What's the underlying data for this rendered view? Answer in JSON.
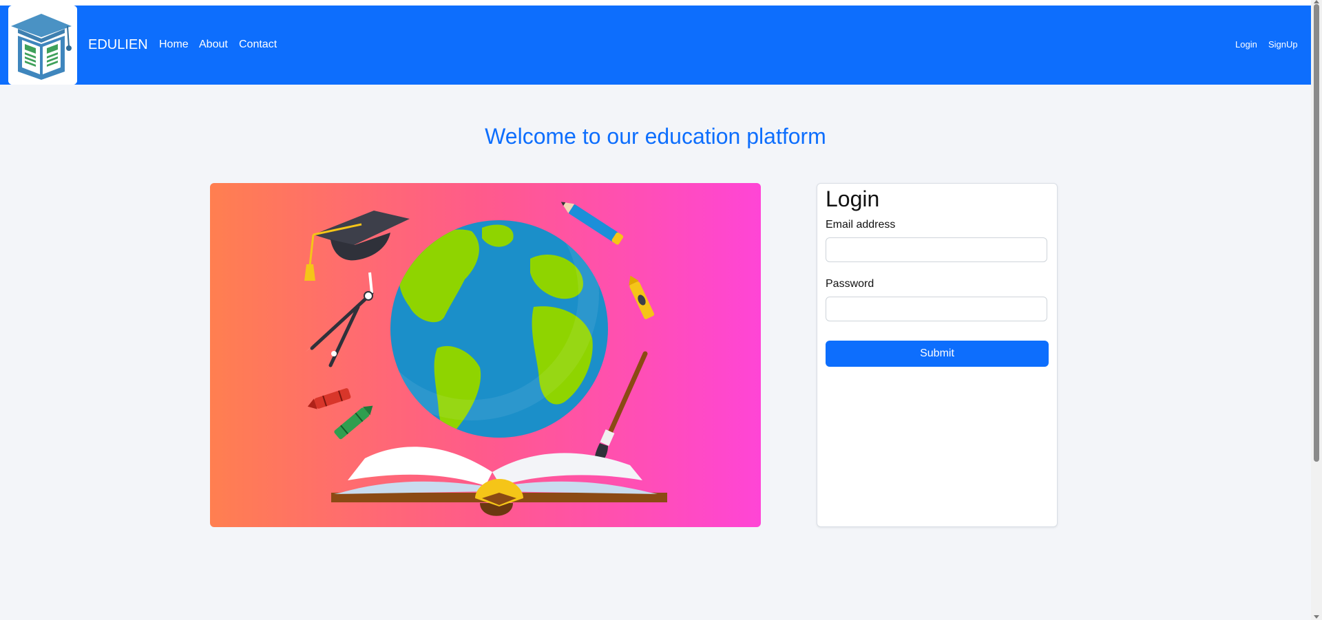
{
  "header": {
    "brand": "EDULIEN",
    "nav_links": [
      "Home",
      "About",
      "Contact"
    ],
    "auth_links": [
      "Login",
      "SignUp"
    ],
    "logo_icon": "school-book-logo"
  },
  "main": {
    "welcome_title": "Welcome to our education platform",
    "hero_image": "education-globe-illustration"
  },
  "login_form": {
    "title": "Login",
    "email_label": "Email address",
    "email_value": "",
    "password_label": "Password",
    "password_value": "",
    "submit_label": "Submit"
  },
  "colors": {
    "primary": "#0d6efd",
    "page_background": "#f3f5f9",
    "hero_gradient_start": "#ff7f50",
    "hero_gradient_end": "#ff45d6"
  }
}
